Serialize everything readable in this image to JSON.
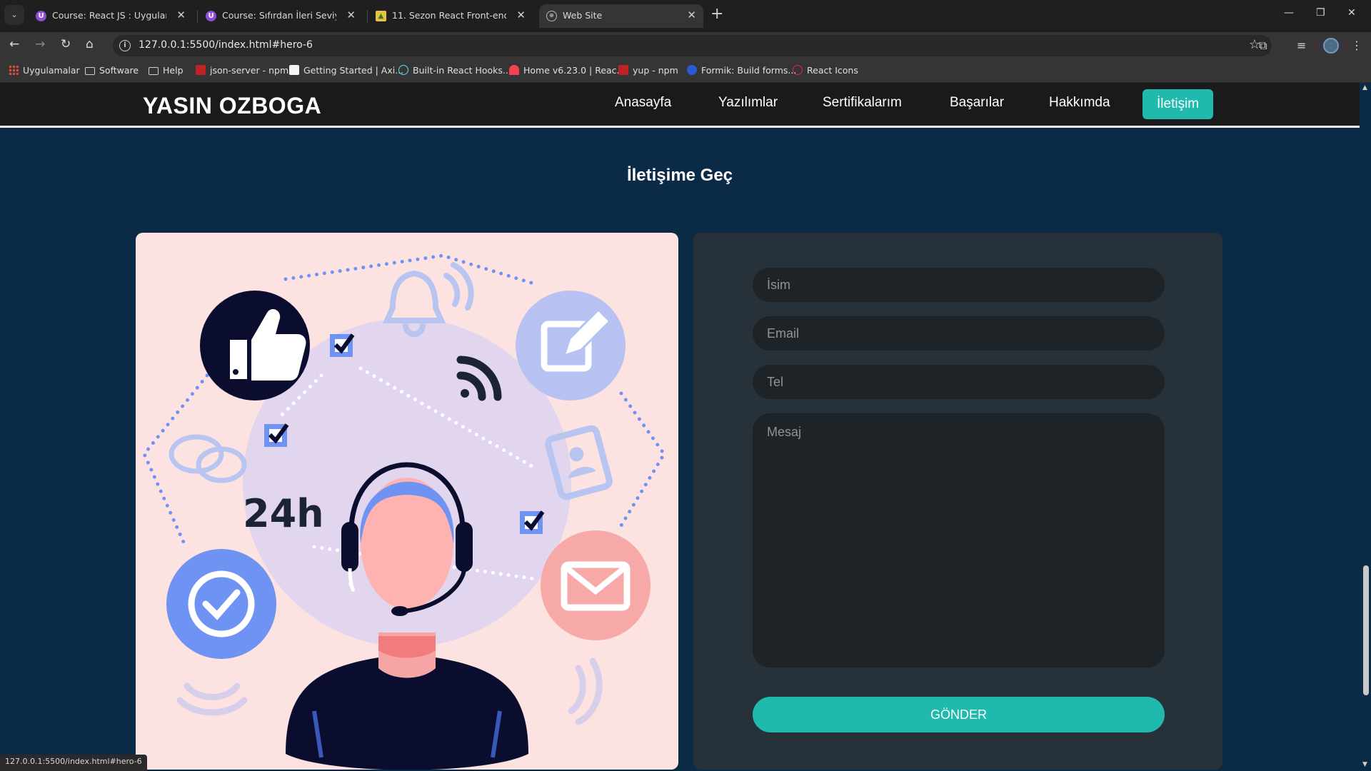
{
  "browser": {
    "tabs": [
      {
        "title": "Course: React JS : Uygulamalı R",
        "icon": "udemy-icon",
        "active": false
      },
      {
        "title": "Course: Sıfırdan İleri Seviye Mo",
        "icon": "udemy-icon",
        "active": false
      },
      {
        "title": "11. Sezon React Front-end Haft",
        "icon": "image-icon",
        "active": false
      },
      {
        "title": "Web Site",
        "icon": "globe-icon",
        "active": true
      }
    ],
    "url": "127.0.0.1:5500/index.html#hero-6",
    "bookmarks": [
      {
        "label": "Uygulamalar",
        "icon": "apps-icon"
      },
      {
        "label": "Software",
        "icon": "folder-icon"
      },
      {
        "label": "Help",
        "icon": "folder-icon"
      },
      {
        "label": "json-server - npm",
        "icon": "npm-icon"
      },
      {
        "label": "Getting Started | Axi...",
        "icon": "axios-icon"
      },
      {
        "label": "Built-in React Hooks...",
        "icon": "react-icon"
      },
      {
        "label": "Home v6.23.0 | Reac...",
        "icon": "react-router-icon"
      },
      {
        "label": "yup - npm",
        "icon": "npm-icon"
      },
      {
        "label": "Formik: Build forms...",
        "icon": "formik-icon"
      },
      {
        "label": "React Icons",
        "icon": "react-icons-icon"
      }
    ],
    "status_url": "127.0.0.1:5500/index.html#hero-6"
  },
  "site": {
    "logo": "YASIN OZBOGA",
    "nav": [
      "Anasayfa",
      "Yazılımlar",
      "Sertifikalarım",
      "Başarılar",
      "Hakkımda",
      "İletişim"
    ],
    "active_nav": "İletişim",
    "accent_color": "#1fb9ad"
  },
  "contact": {
    "title": "İletişime Geç",
    "illustration_text": "24h",
    "fields": {
      "name_placeholder": "İsim",
      "email_placeholder": "Email",
      "tel_placeholder": "Tel",
      "message_placeholder": "Mesaj"
    },
    "submit_label": "GÖNDER"
  }
}
